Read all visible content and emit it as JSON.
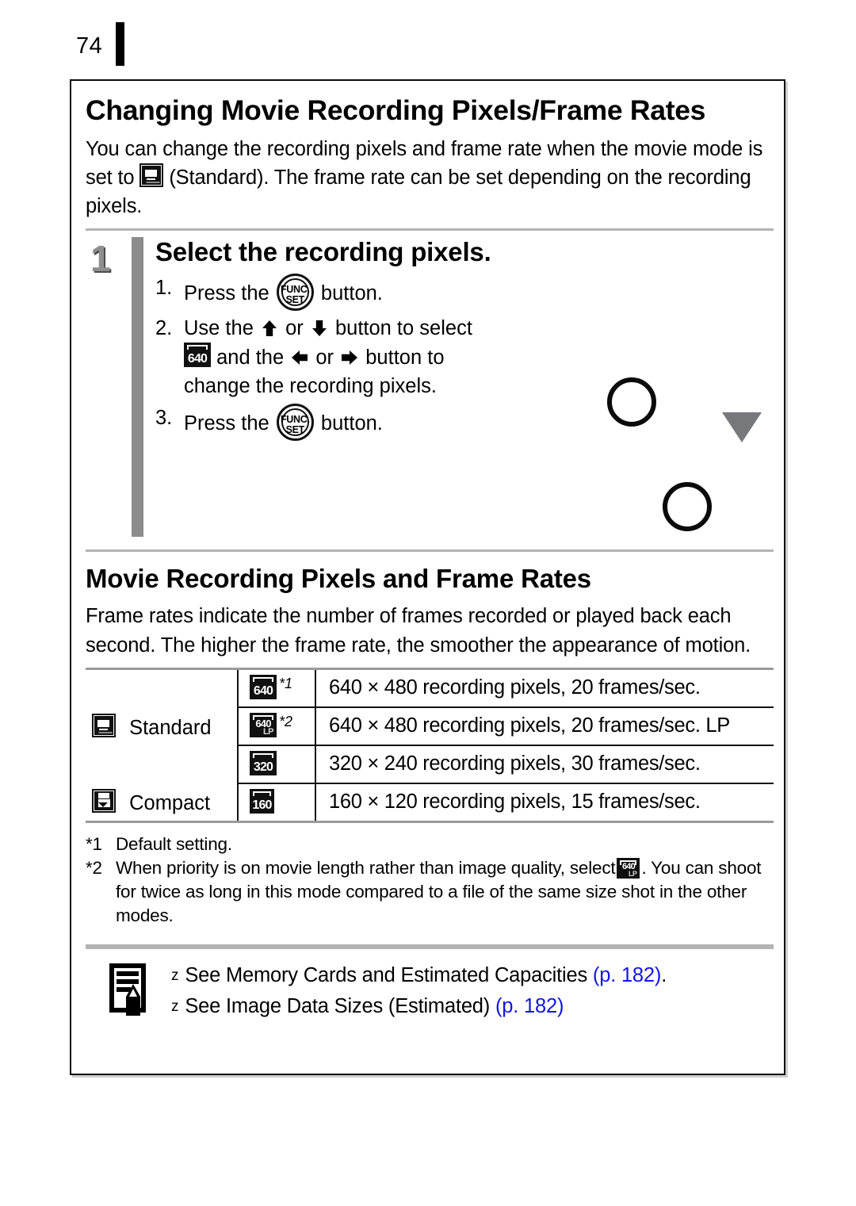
{
  "page": {
    "number": "74"
  },
  "section1": {
    "title": "Changing Movie Recording Pixels/Frame Rates",
    "intro_part1": "You can change the recording pixels and frame rate when the movie mode is set to",
    "intro_part2": "(Standard). The frame rate can be set depending on the recording pixels."
  },
  "step": {
    "number": "1",
    "title": "Select the recording pixels.",
    "items": [
      {
        "label": "1.",
        "text_a": "Press the",
        "icon": "func-set-button",
        "text_b": "button."
      },
      {
        "label": "2.",
        "text_a": "Use the",
        "icon_a": "arrow-up",
        "or": "or",
        "icon_b": "arrow-down",
        "text_b": "button to select",
        "text_c": "and the",
        "icon_c": "arrow-left",
        "icon_d": "arrow-right",
        "text_d": "button to",
        "text_e": "change the recording pixels."
      },
      {
        "label": "3.",
        "text_a": "Press the",
        "icon": "func-set-button",
        "text_b": "button."
      }
    ],
    "func_button": {
      "line1": "FUNC.",
      "line2": "SET"
    },
    "res_icon": {
      "num": "640"
    }
  },
  "section2": {
    "title": "Movie Recording Pixels and Frame Rates",
    "intro": "Frame rates indicate the number of frames recorded or played back each second. The higher the frame rate, the smoother the appearance of motion."
  },
  "table": {
    "rows": [
      {
        "mode": "Standard",
        "mode_icon": "movie-standard-icon",
        "res_icon": "640",
        "res_icon_lp": "",
        "footnote": "*1",
        "description": "640 × 480 recording pixels, 20 frames/sec."
      },
      {
        "mode": "",
        "mode_icon": "",
        "res_icon": "640",
        "res_icon_lp": "LP",
        "footnote": "*2",
        "description": "640 × 480 recording pixels, 20 frames/sec. LP"
      },
      {
        "mode": "",
        "mode_icon": "",
        "res_icon": "320",
        "res_icon_lp": "",
        "footnote": "",
        "description": "320 × 240 recording pixels, 30 frames/sec."
      },
      {
        "mode": "Compact",
        "mode_icon": "movie-compact-icon",
        "res_icon": "160",
        "res_icon_lp": "",
        "footnote": "",
        "description": "160 × 120 recording pixels, 15 frames/sec."
      }
    ]
  },
  "footnotes": [
    {
      "marker": "*1",
      "text": "Default setting."
    },
    {
      "marker": "*2",
      "text_a": "When priority is on movie length rather than image quality, select",
      "icon": "640-lp-icon",
      "text_b": ". You can shoot for twice as long in this mode compared to a file of the same size shot in the other modes."
    }
  ],
  "see_also": {
    "icon": "note-pencil-icon",
    "bullet": "z",
    "lines": [
      {
        "text": "See Memory Cards and Estimated Capacities",
        "page_ref": "(p. 182)",
        "trailing": "."
      },
      {
        "text": "See Image Data Sizes (Estimated)",
        "page_ref": "(p. 182)",
        "trailing": ""
      }
    ]
  },
  "colors": {
    "page_ref_blue": "#1414e6",
    "step_bar_gray": "#8c8c8c",
    "rule_gray": "#b4b4b4",
    "triangle_gray": "#77787c"
  }
}
